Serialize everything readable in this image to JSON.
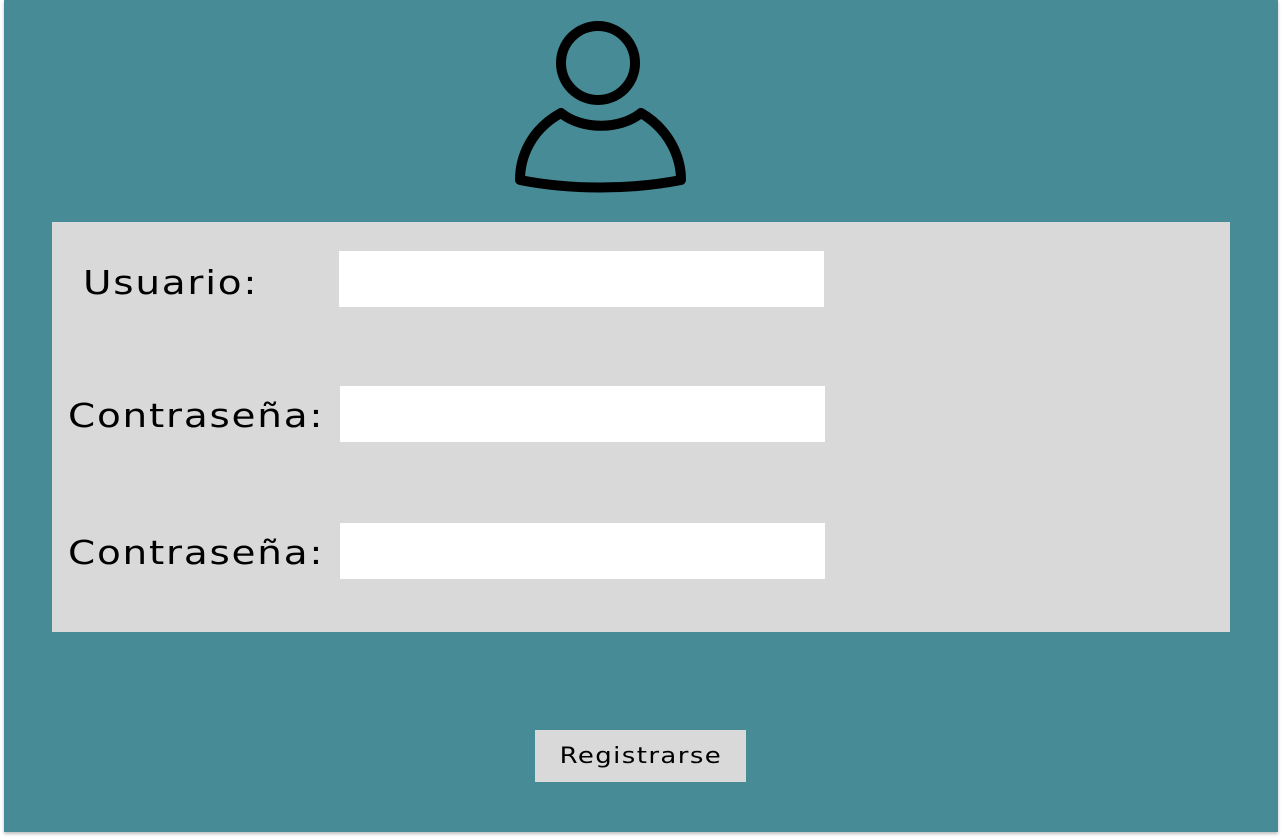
{
  "form": {
    "username_label": "Usuario:",
    "password_label": "Contraseña:",
    "confirm_password_label": "Contraseña:",
    "username_value": "",
    "password_value": "",
    "confirm_password_value": ""
  },
  "actions": {
    "register_label": "Registrarse"
  },
  "icons": {
    "avatar": "user-icon"
  },
  "colors": {
    "background": "#468b95",
    "panel": "#d9d9d9",
    "field": "#ffffff",
    "text": "#000000"
  }
}
